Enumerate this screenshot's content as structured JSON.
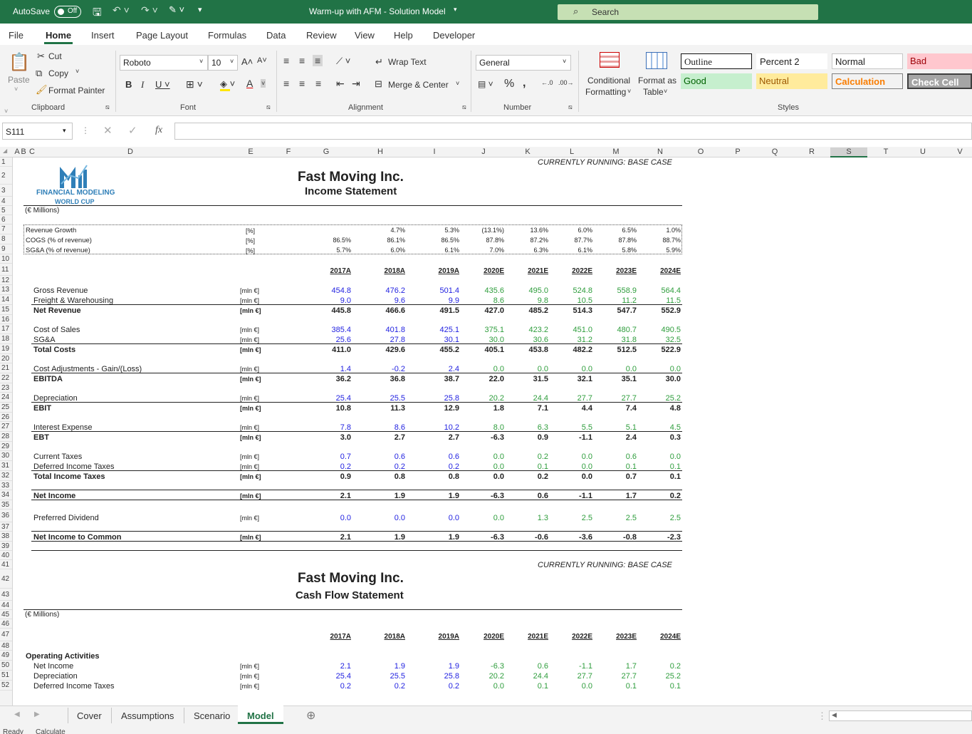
{
  "titlebar": {
    "autosave": "AutoSave",
    "toggle": "Off",
    "doc_title": "Warm-up with AFM - Solution Model",
    "search": "Search"
  },
  "menu": [
    "File",
    "Home",
    "Insert",
    "Page Layout",
    "Formulas",
    "Data",
    "Review",
    "View",
    "Help",
    "Developer"
  ],
  "ribbon": {
    "clipboard": {
      "paste": "Paste",
      "cut": "Cut",
      "copy": "Copy",
      "format_painter": "Format Painter",
      "label": "Clipboard"
    },
    "font": {
      "name": "Roboto",
      "size": "10",
      "label": "Font"
    },
    "alignment": {
      "wrap": "Wrap Text",
      "merge": "Merge & Center",
      "label": "Alignment"
    },
    "number": {
      "format": "General",
      "label": "Number"
    },
    "styles": {
      "cond1": "Conditional",
      "cond2": "Formatting",
      "fmt1": "Format as",
      "fmt2": "Table",
      "label": "Styles",
      "cells": {
        "outline": "Outline",
        "percent2": "Percent 2",
        "normal": "Normal",
        "bad": "Bad",
        "good": "Good",
        "neutral": "Neutral",
        "calculation": "Calculation",
        "check": "Check Cell"
      }
    }
  },
  "formula_bar": {
    "name_box": "S111",
    "fx": "fx",
    "value": ""
  },
  "columns": [
    "A",
    "B",
    "C",
    "D",
    "E",
    "F",
    "G",
    "H",
    "I",
    "J",
    "K",
    "L",
    "M",
    "N",
    "O",
    "P",
    "Q",
    "R",
    "S",
    "T",
    "U",
    "V"
  ],
  "rows": [
    "1",
    "2",
    "3",
    "4",
    "5",
    "6",
    "7",
    "8",
    "9",
    "10",
    "11",
    "12",
    "13",
    "14",
    "15",
    "16",
    "17",
    "18",
    "19",
    "20",
    "21",
    "22",
    "23",
    "24",
    "25",
    "26",
    "27",
    "28",
    "29",
    "30",
    "31",
    "32",
    "33",
    "34",
    "35",
    "36",
    "37",
    "38",
    "39",
    "40",
    "41",
    "42",
    "43",
    "44",
    "45",
    "46",
    "47",
    "48",
    "49",
    "50",
    "51",
    "52"
  ],
  "logo": {
    "line1": "FINANCIAL MODELING",
    "line2": "WORLD CUP"
  },
  "income": {
    "running": "CURRENTLY RUNNING: BASE CASE",
    "company": "Fast Moving Inc.",
    "title": "Income Statement",
    "currency": "(€ Millions)",
    "assumptions": [
      {
        "label": "Revenue Growth",
        "unit": "[%]",
        "values": [
          "",
          "4.7%",
          "5.3%",
          "(13.1%)",
          "13.6%",
          "6.0%",
          "6.5%",
          "1.0%"
        ]
      },
      {
        "label": "COGS (% of revenue)",
        "unit": "[%]",
        "values": [
          "86.5%",
          "86.1%",
          "86.5%",
          "87.8%",
          "87.2%",
          "87.7%",
          "87.8%",
          "88.7%"
        ]
      },
      {
        "label": "SG&A (% of revenue)",
        "unit": "[%]",
        "values": [
          "5.7%",
          "6.0%",
          "6.1%",
          "7.0%",
          "6.3%",
          "6.1%",
          "5.8%",
          "5.9%"
        ]
      }
    ],
    "years": [
      "2017A",
      "2018A",
      "2019A",
      "2020E",
      "2021E",
      "2022E",
      "2023E",
      "2024E"
    ],
    "lines": [
      {
        "row": 13,
        "label": "Gross Revenue",
        "unit": "[mln €]",
        "values": [
          "454.8",
          "476.2",
          "501.4",
          "435.6",
          "495.0",
          "524.8",
          "558.9",
          "564.4"
        ],
        "style": "input"
      },
      {
        "row": 14,
        "label": "Freight & Warehousing",
        "unit": "[mln €]",
        "values": [
          "9.0",
          "9.6",
          "9.9",
          "8.6",
          "9.8",
          "10.5",
          "11.2",
          "11.5"
        ],
        "style": "input"
      },
      {
        "row": 15,
        "label": "Net Revenue",
        "unit": "[mln €]",
        "values": [
          "445.8",
          "466.6",
          "491.5",
          "427.0",
          "485.2",
          "514.3",
          "547.7",
          "552.9"
        ],
        "style": "total"
      },
      {
        "row": 17,
        "label": "Cost of Sales",
        "unit": "[mln €]",
        "values": [
          "385.4",
          "401.8",
          "425.1",
          "375.1",
          "423.2",
          "451.0",
          "480.7",
          "490.5"
        ],
        "style": "input"
      },
      {
        "row": 18,
        "label": "SG&A",
        "unit": "[mln €]",
        "values": [
          "25.6",
          "27.8",
          "30.1",
          "30.0",
          "30.6",
          "31.2",
          "31.8",
          "32.5"
        ],
        "style": "input"
      },
      {
        "row": 19,
        "label": "Total Costs",
        "unit": "[mln €]",
        "values": [
          "411.0",
          "429.6",
          "455.2",
          "405.1",
          "453.8",
          "482.2",
          "512.5",
          "522.9"
        ],
        "style": "total"
      },
      {
        "row": 21,
        "label": "Cost Adjustments - Gain/(Loss)",
        "unit": "[mln €]",
        "values": [
          "1.4",
          "-0.2",
          "2.4",
          "0.0",
          "0.0",
          "0.0",
          "0.0",
          "0.0"
        ],
        "style": "input"
      },
      {
        "row": 22,
        "label": "EBITDA",
        "unit": "[mln €]",
        "values": [
          "36.2",
          "36.8",
          "38.7",
          "22.0",
          "31.5",
          "32.1",
          "35.1",
          "30.0"
        ],
        "style": "total"
      },
      {
        "row": 24,
        "label": "Depreciation",
        "unit": "[mln €]",
        "values": [
          "25.4",
          "25.5",
          "25.8",
          "20.2",
          "24.4",
          "27.7",
          "27.7",
          "25.2"
        ],
        "style": "input"
      },
      {
        "row": 25,
        "label": "EBIT",
        "unit": "[mln €]",
        "values": [
          "10.8",
          "11.3",
          "12.9",
          "1.8",
          "7.1",
          "4.4",
          "7.4",
          "4.8"
        ],
        "style": "total"
      },
      {
        "row": 27,
        "label": "Interest Expense",
        "unit": "[mln €]",
        "values": [
          "7.8",
          "8.6",
          "10.2",
          "8.0",
          "6.3",
          "5.5",
          "5.1",
          "4.5"
        ],
        "style": "input"
      },
      {
        "row": 28,
        "label": "EBT",
        "unit": "[mln €]",
        "values": [
          "3.0",
          "2.7",
          "2.7",
          "-6.3",
          "0.9",
          "-1.1",
          "2.4",
          "0.3"
        ],
        "style": "total"
      },
      {
        "row": 30,
        "label": "Current Taxes",
        "unit": "[mln €]",
        "values": [
          "0.7",
          "0.6",
          "0.6",
          "0.0",
          "0.2",
          "0.0",
          "0.6",
          "0.0"
        ],
        "style": "input"
      },
      {
        "row": 31,
        "label": "Deferred Income Taxes",
        "unit": "[mln €]",
        "values": [
          "0.2",
          "0.2",
          "0.2",
          "0.0",
          "0.1",
          "0.0",
          "0.1",
          "0.1"
        ],
        "style": "input"
      },
      {
        "row": 32,
        "label": "Total Income Taxes",
        "unit": "[mln €]",
        "values": [
          "0.9",
          "0.8",
          "0.8",
          "0.0",
          "0.2",
          "0.0",
          "0.7",
          "0.1"
        ],
        "style": "total"
      },
      {
        "row": 34,
        "label": "Net Income",
        "unit": "[mln €]",
        "values": [
          "2.1",
          "1.9",
          "1.9",
          "-6.3",
          "0.6",
          "-1.1",
          "1.7",
          "0.2"
        ],
        "style": "boxed"
      },
      {
        "row": 36,
        "label": "Preferred Dividend",
        "unit": "[mln €]",
        "values": [
          "0.0",
          "0.0",
          "0.0",
          "0.0",
          "1.3",
          "2.5",
          "2.5",
          "2.5"
        ],
        "style": "input"
      },
      {
        "row": 38,
        "label": "Net Income to Common",
        "unit": "[mln €]",
        "values": [
          "2.1",
          "1.9",
          "1.9",
          "-6.3",
          "-0.6",
          "-3.6",
          "-0.8",
          "-2.3"
        ],
        "style": "boxed"
      }
    ]
  },
  "cashflow": {
    "running": "CURRENTLY RUNNING: BASE CASE",
    "company": "Fast Moving Inc.",
    "title": "Cash Flow Statement",
    "currency": "(€ Millions)",
    "years": [
      "2017A",
      "2018A",
      "2019A",
      "2020E",
      "2021E",
      "2022E",
      "2023E",
      "2024E"
    ],
    "section": "Operating Activities",
    "lines": [
      {
        "row": 50,
        "label": "Net Income",
        "unit": "[mln €]",
        "values": [
          "2.1",
          "1.9",
          "1.9",
          "-6.3",
          "0.6",
          "-1.1",
          "1.7",
          "0.2"
        ]
      },
      {
        "row": 51,
        "label": "Depreciation",
        "unit": "[mln €]",
        "values": [
          "25.4",
          "25.5",
          "25.8",
          "20.2",
          "24.4",
          "27.7",
          "27.7",
          "25.2"
        ]
      },
      {
        "row": 52,
        "label": "Deferred Income Taxes",
        "unit": "[mln €]",
        "values": [
          "0.2",
          "0.2",
          "0.2",
          "0.0",
          "0.1",
          "0.0",
          "0.1",
          "0.1"
        ]
      }
    ]
  },
  "tabs": [
    "Cover",
    "Assumptions",
    "Scenario",
    "Model"
  ],
  "active_tab": "Model",
  "status": {
    "left": "Ready",
    "mode": "Calculate"
  },
  "colors": {
    "excel_green": "#217346",
    "input_blue": "#1f1fe0",
    "forecast_green": "#2e9d3c"
  }
}
